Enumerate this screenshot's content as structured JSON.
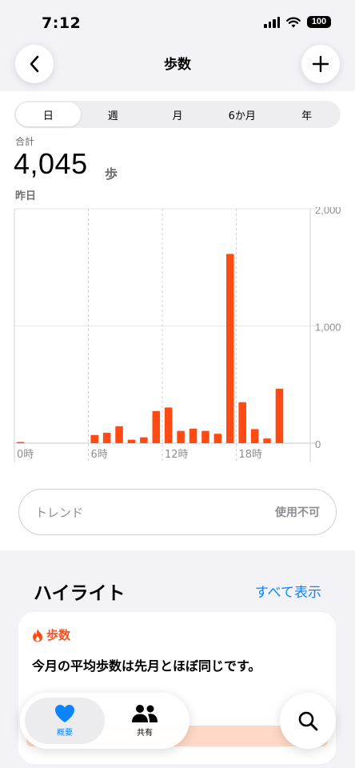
{
  "status": {
    "time": "7:12",
    "battery": "100"
  },
  "nav": {
    "title": "歩数"
  },
  "segments": [
    "日",
    "週",
    "月",
    "6か月",
    "年"
  ],
  "selected_segment": "日",
  "summary": {
    "total_label": "合計",
    "value": "4,045",
    "unit": "歩",
    "date": "昨日"
  },
  "chart_data": {
    "type": "bar",
    "x_tick_labels": [
      "0時",
      "6時",
      "12時",
      "18時"
    ],
    "y_tick_labels": [
      "2,000",
      "1,000",
      "0"
    ],
    "ylim": [
      0,
      2000
    ],
    "bar_color": "#ff4a14",
    "grid": true,
    "categories": [
      0,
      1,
      2,
      3,
      4,
      5,
      6,
      7,
      8,
      9,
      10,
      11,
      12,
      13,
      14,
      15,
      16,
      17,
      18,
      19,
      20,
      21,
      22,
      23
    ],
    "values": [
      10,
      0,
      0,
      0,
      0,
      0,
      70,
      90,
      145,
      30,
      50,
      275,
      305,
      105,
      125,
      105,
      80,
      1615,
      350,
      120,
      40,
      465,
      0,
      0
    ]
  },
  "trend": {
    "label": "トレンド",
    "value": "使用不可"
  },
  "highlights": {
    "title": "ハイライト",
    "see_all": "すべて表示",
    "card": {
      "category": "歩数",
      "text": "今月の平均歩数は先月とほぼ同じです。"
    }
  },
  "tabs": {
    "summary": "概要",
    "sharing": "共有"
  },
  "colors": {
    "accent": "#0a84ff",
    "steps": "#ff4a14"
  }
}
